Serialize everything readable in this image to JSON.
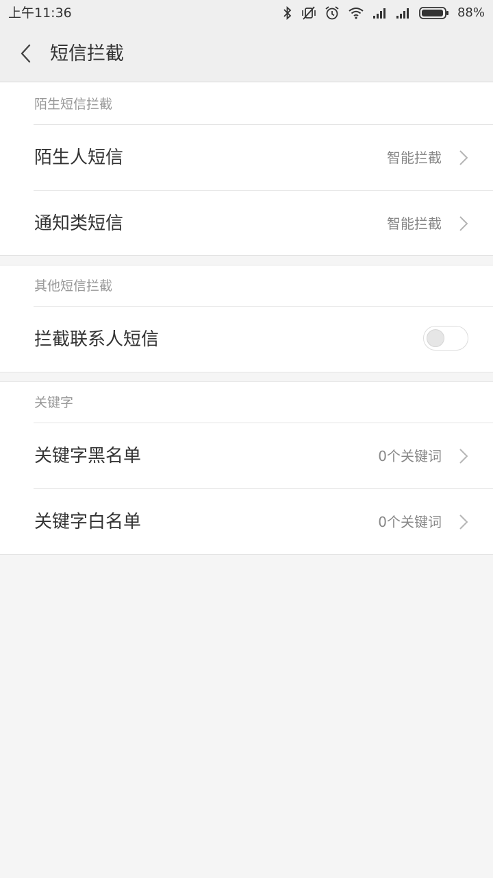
{
  "status_bar": {
    "time": "上午11:36",
    "icons": [
      "bluetooth-icon",
      "vibrate-off-icon",
      "alarm-icon",
      "wifi-icon",
      "signal-icon",
      "signal-icon",
      "battery-icon"
    ],
    "battery": "88%"
  },
  "header": {
    "back_icon": "chevron-left-icon",
    "title": "短信拦截"
  },
  "sections": [
    {
      "header": "陌生短信拦截",
      "rows": [
        {
          "label": "陌生人短信",
          "value": "智能拦截"
        },
        {
          "label": "通知类短信",
          "value": "智能拦截"
        }
      ]
    },
    {
      "header": "其他短信拦截",
      "rows": [
        {
          "label": "拦截联系人短信",
          "toggle": false
        }
      ]
    },
    {
      "header": "关键字",
      "rows": [
        {
          "label": "关键字黑名单",
          "value": "0个关键词"
        },
        {
          "label": "关键字白名单",
          "value": "0个关键词"
        }
      ]
    }
  ],
  "colors": {
    "header_bg": "#efefef",
    "page_bg": "#f5f5f5",
    "card_bg": "#ffffff",
    "text_primary": "#333333",
    "text_secondary": "#999999"
  }
}
